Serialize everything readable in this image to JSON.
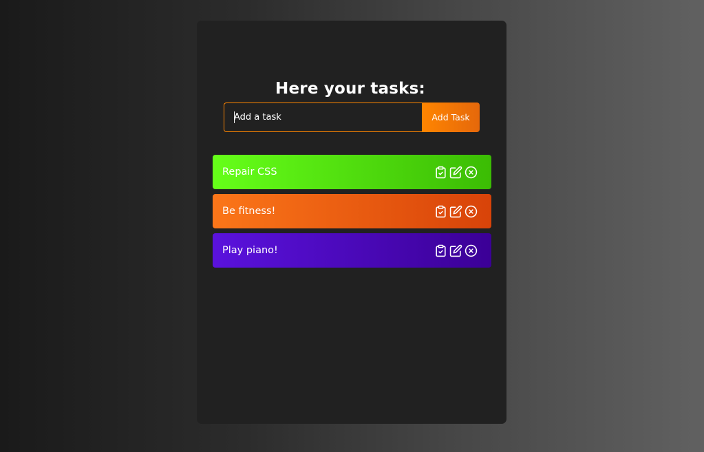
{
  "app": {
    "title": "Here your tasks:"
  },
  "form": {
    "input_placeholder": "Add a task",
    "input_value": "",
    "add_button_label": "Add Task"
  },
  "tasks": [
    {
      "text": "Repair CSS",
      "gradient_start": "#66ff19",
      "gradient_end": "#3bbc04",
      "icons": [
        "clipboard-check-icon",
        "edit-icon",
        "close-circle-icon"
      ]
    },
    {
      "text": "Be fitness!",
      "gradient_start": "#fb7619",
      "gradient_end": "#d84309",
      "icons": [
        "clipboard-check-icon",
        "edit-icon",
        "close-circle-icon"
      ]
    },
    {
      "text": "Play piano!",
      "gradient_start": "#5a12dd",
      "gradient_end": "#3b0096",
      "icons": [
        "clipboard-check-icon",
        "edit-icon",
        "close-circle-icon"
      ]
    }
  ],
  "colors": {
    "accent": "#ff8500",
    "card_background": "#212121",
    "text": "#ffffff"
  }
}
